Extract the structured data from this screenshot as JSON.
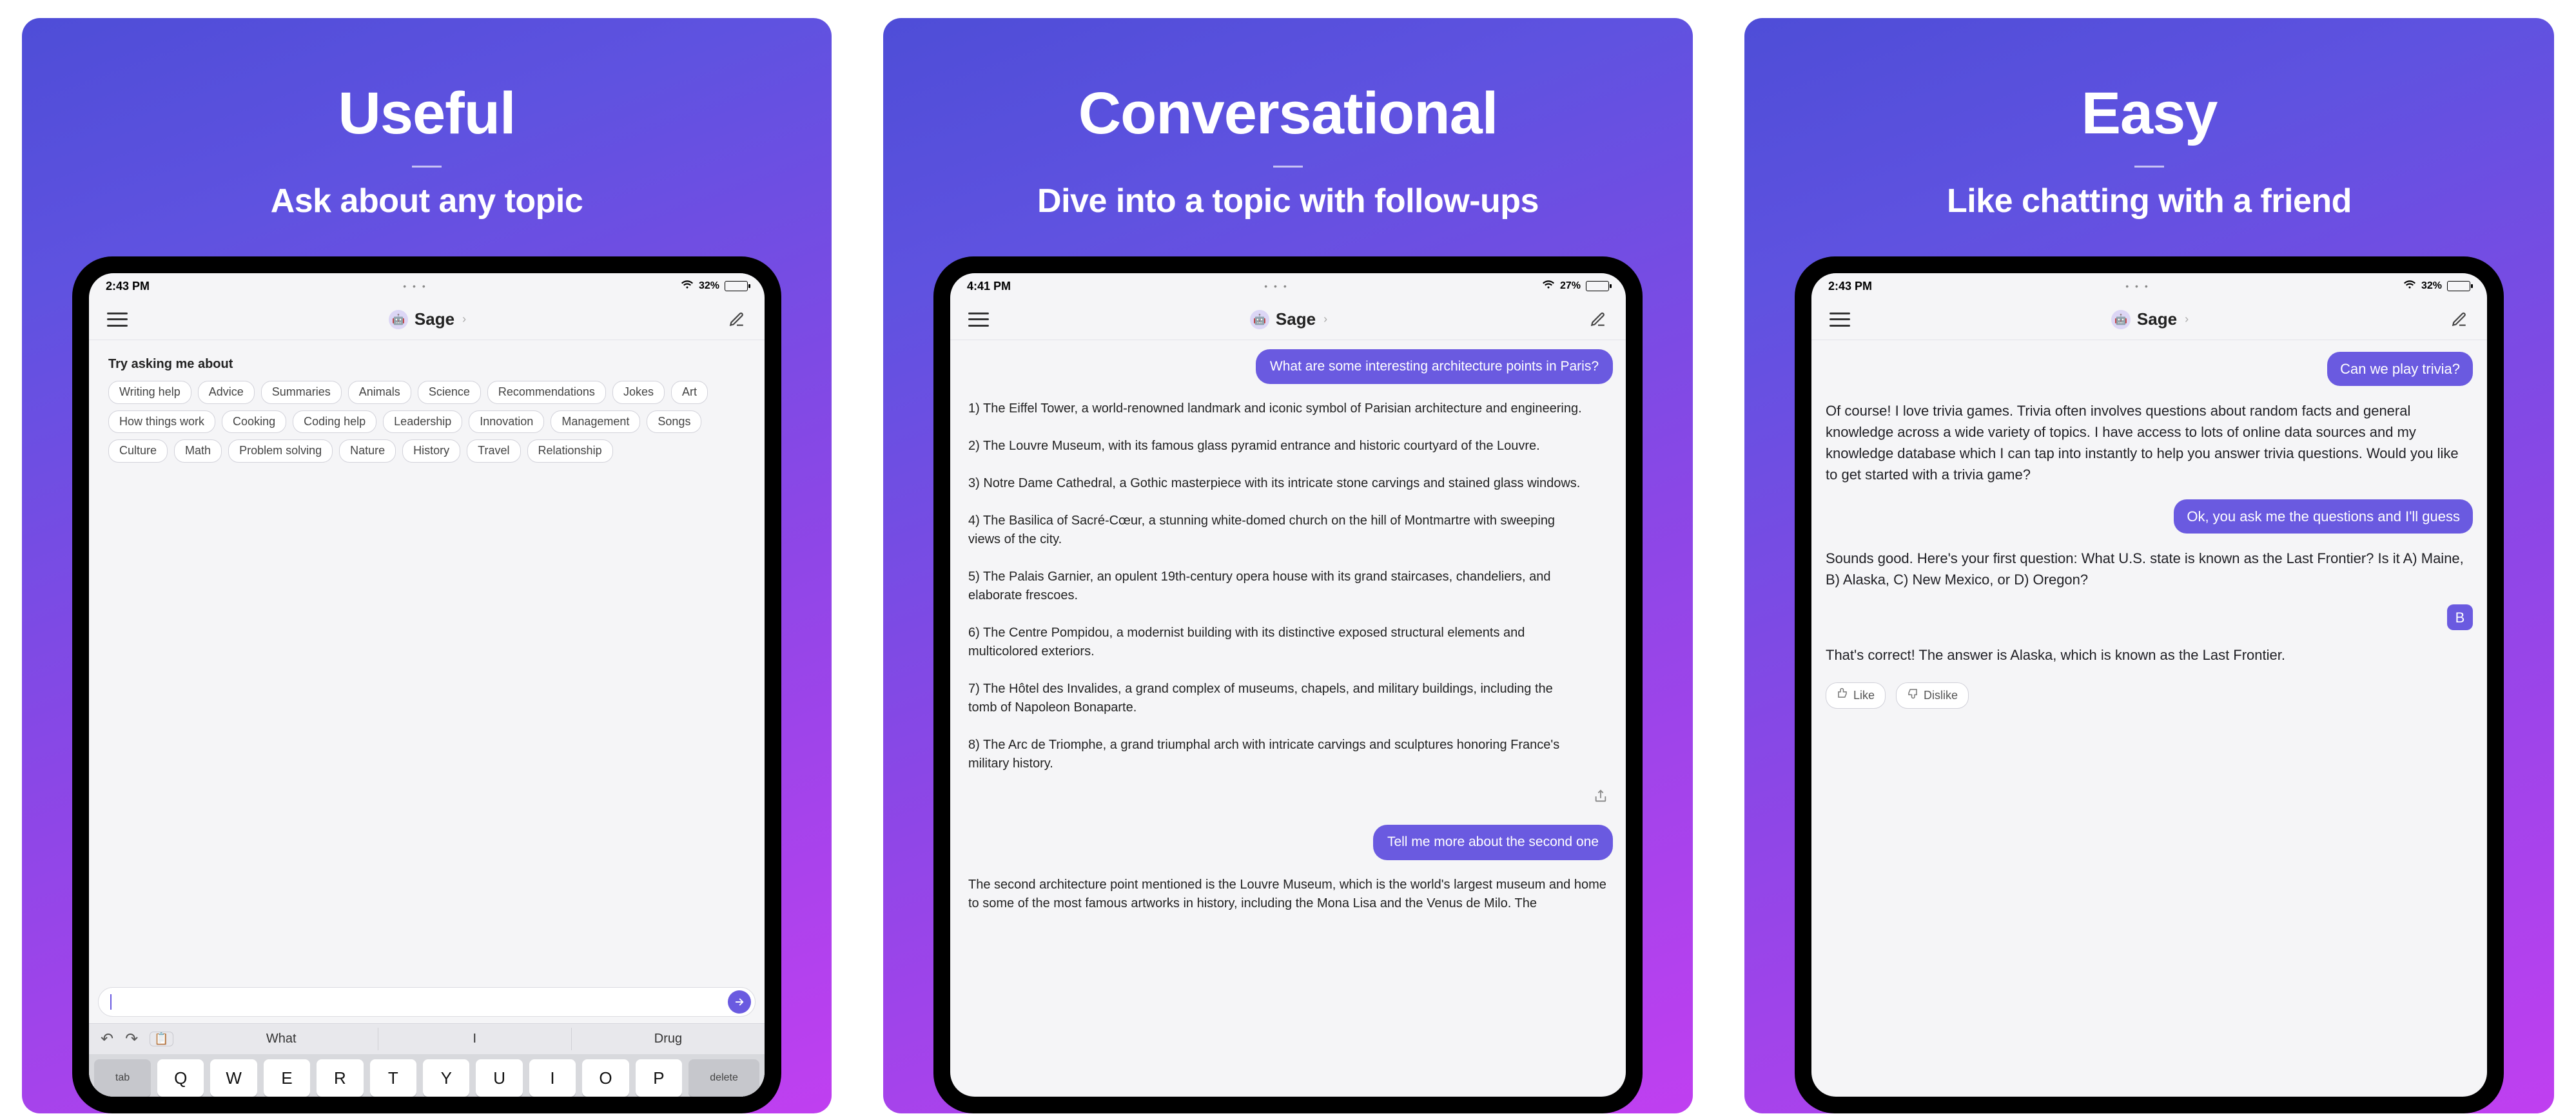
{
  "cards": [
    {
      "heading": "Useful",
      "subtitle": "Ask about any topic",
      "time": "2:43 PM",
      "battery_pct": "32%",
      "app_title": "Sage",
      "prompt_title": "Try asking me about",
      "chips": [
        "Writing help",
        "Advice",
        "Summaries",
        "Animals",
        "Science",
        "Recommendations",
        "Jokes",
        "Art",
        "How things work",
        "Cooking",
        "Coding help",
        "Leadership",
        "Innovation",
        "Management",
        "Songs",
        "Culture",
        "Math",
        "Problem solving",
        "Nature",
        "History",
        "Travel",
        "Relationship"
      ],
      "suggest": [
        "What",
        "I",
        "Drug"
      ],
      "kb_row": [
        "Q",
        "W",
        "E",
        "R",
        "T",
        "Y",
        "U",
        "I",
        "O",
        "P"
      ],
      "kb_tab": "tab",
      "kb_delete": "delete"
    },
    {
      "heading": "Conversational",
      "subtitle": "Dive into a topic with follow-ups",
      "time": "4:41 PM",
      "battery_pct": "27%",
      "app_title": "Sage",
      "user1": "What are some interesting architecture points in Paris?",
      "bot1": "1) The Eiffel Tower, a world-renowned landmark and iconic symbol of Parisian architecture and engineering.\n\n2) The Louvre Museum, with its famous glass pyramid entrance and historic courtyard of the Louvre.\n\n3) Notre Dame Cathedral, a Gothic masterpiece with its intricate stone carvings and stained glass windows.\n\n4) The Basilica of Sacré-Cœur, a stunning white-domed church on the hill of Montmartre with sweeping views of the city.\n\n5) The Palais Garnier, an opulent 19th-century opera house with its grand staircases, chandeliers, and elaborate frescoes.\n\n6) The Centre Pompidou, a modernist building with its distinctive exposed structural elements and multicolored exteriors.\n\n7) The Hôtel des Invalides, a grand complex of museums, chapels, and military buildings, including the tomb of Napoleon Bonaparte.\n\n8) The Arc de Triomphe, a grand triumphal arch with intricate carvings and sculptures honoring France's military history.",
      "user2": "Tell me more about the second one",
      "bot2": "The second architecture point mentioned is the Louvre Museum, which is the world's largest museum and home to some of the most famous artworks in history, including the Mona Lisa and the Venus de Milo. The"
    },
    {
      "heading": "Easy",
      "subtitle": "Like chatting with a friend",
      "time": "2:43 PM",
      "battery_pct": "32%",
      "app_title": "Sage",
      "user1": "Can we play trivia?",
      "bot1": "Of course! I love trivia games. Trivia often involves questions about random facts and general knowledge across a wide variety of topics. I have access to lots of online data sources and my knowledge database which I can tap into instantly to help you answer trivia questions. Would you like to get started with a trivia game?",
      "user2": "Ok, you ask me the questions and I'll guess",
      "bot2": "Sounds good. Here's your first question: What U.S. state is known as the Last Frontier? Is it A) Maine, B) Alaska, C) New Mexico, or D) Oregon?",
      "answer": "B",
      "bot3": "That's correct! The answer is Alaska, which is known as the Last Frontier.",
      "like": "Like",
      "dislike": "Dislike"
    }
  ]
}
